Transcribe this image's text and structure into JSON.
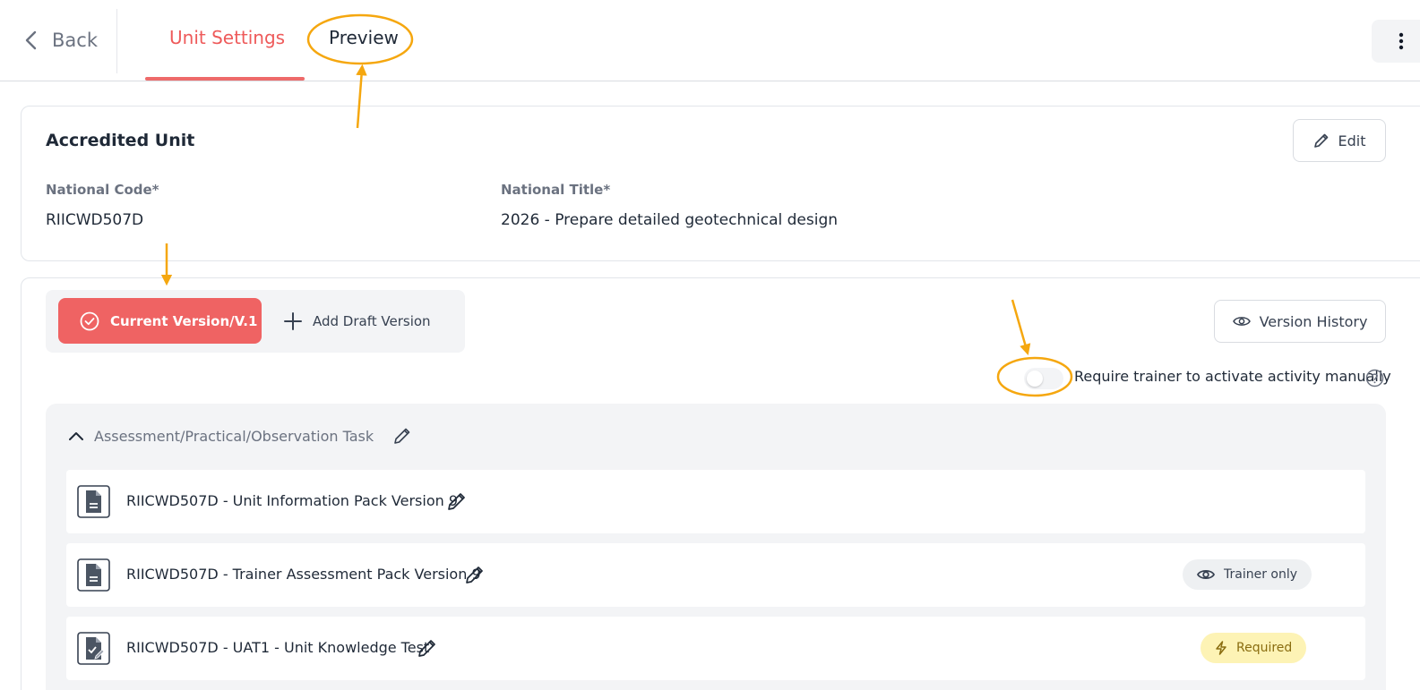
{
  "header": {
    "back_label": "Back",
    "tabs": [
      {
        "label": "Unit Settings",
        "active": true
      },
      {
        "label": "Preview",
        "active": false
      }
    ]
  },
  "unit_card": {
    "title": "Accredited Unit",
    "edit_label": "Edit",
    "national_code_label": "National Code*",
    "national_code_value": "RIICWD507D",
    "national_title_label": "National Title*",
    "national_title_value": "2026 - Prepare detailed geotechnical design"
  },
  "versions": {
    "current_label": "Current Version/V.1",
    "add_draft_label": "Add Draft Version",
    "history_label": "Version History",
    "require_trainer_label": "Require trainer to activate activity manually",
    "require_trainer_enabled": false
  },
  "section": {
    "title": "Assessment/Practical/Observation Task",
    "items": [
      {
        "name": "RIICWD507D - Unit Information Pack Version 9",
        "icon": "document-icon"
      },
      {
        "name": "RIICWD507D - Trainer Assessment Pack Version 9",
        "icon": "document-icon",
        "badge": "Trainer only"
      },
      {
        "name": "RIICWD507D - UAT1 - Unit Knowledge Test",
        "icon": "edit-document-icon",
        "badge": "Required"
      }
    ]
  },
  "colors": {
    "accent": "#ef6363",
    "annotation": "#f5a70f",
    "required_badge_bg": "#fdf3b5"
  }
}
